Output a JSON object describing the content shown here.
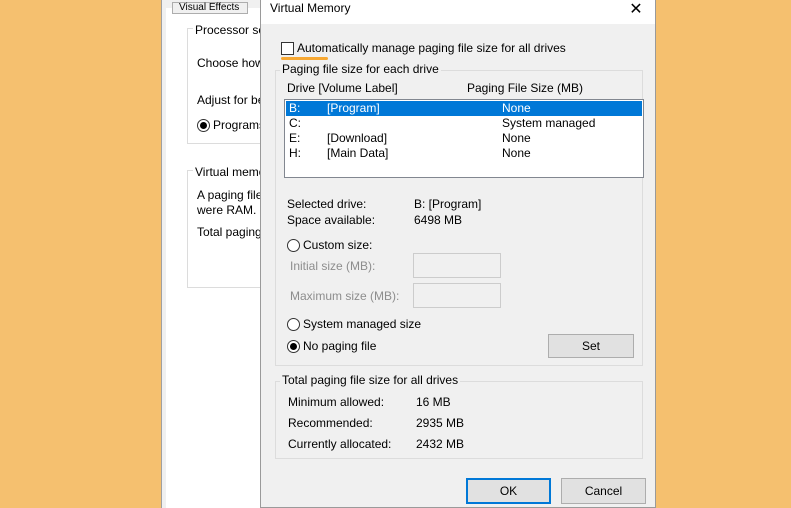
{
  "background_dialog": {
    "tab_label": "Visual Effects",
    "processor_group": "Processor sch",
    "choose_text": "Choose how",
    "adjust_text": "Adjust for be",
    "programs_label": "Programs",
    "vm_group": "Virtual memo",
    "paging_line1": "A paging file",
    "paging_line2": "were RAM.",
    "total_paging": "Total paging"
  },
  "dialog": {
    "title": "Virtual Memory",
    "close_glyph": "✕",
    "auto_manage_label": "Automatically manage paging file size for all drives",
    "auto_manage_checked": false,
    "paging_group_title": "Paging file size for each drive",
    "col_drive": "Drive  [Volume Label]",
    "col_size": "Paging File Size (MB)",
    "drives": [
      {
        "letter": "B:",
        "label": "[Program]",
        "size": "None",
        "selected": true
      },
      {
        "letter": "C:",
        "label": "",
        "size": "System managed",
        "selected": false
      },
      {
        "letter": "E:",
        "label": "[Download]",
        "size": "None",
        "selected": false
      },
      {
        "letter": "H:",
        "label": "[Main Data]",
        "size": "None",
        "selected": false
      }
    ],
    "selected_drive_label": "Selected drive:",
    "selected_drive_value": "B:  [Program]",
    "space_available_label": "Space available:",
    "space_available_value": "6498 MB",
    "custom_size_label": "Custom size:",
    "initial_size_label": "Initial size (MB):",
    "maximum_size_label": "Maximum size (MB):",
    "system_managed_label": "System managed size",
    "no_paging_label": "No paging file",
    "set_button": "Set",
    "total_group_title": "Total paging file size for all drives",
    "min_allowed_label": "Minimum allowed:",
    "min_allowed_value": "16 MB",
    "recommended_label": "Recommended:",
    "recommended_value": "2935 MB",
    "currently_label": "Currently allocated:",
    "currently_value": "2432 MB",
    "ok_button": "OK",
    "cancel_button": "Cancel"
  },
  "colors": {
    "background": "#F5C06F",
    "accent": "#0078D7",
    "highlight": "#F7A833"
  }
}
